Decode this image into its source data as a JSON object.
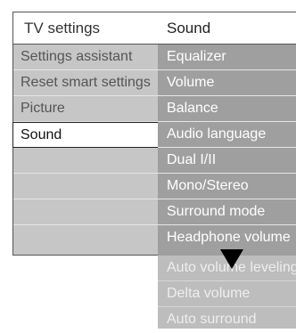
{
  "header": {
    "left_title": "TV settings",
    "right_title": "Sound"
  },
  "left_menu": {
    "items": [
      {
        "label": "Settings assistant"
      },
      {
        "label": "Reset smart settings"
      },
      {
        "label": "Picture"
      },
      {
        "label": "Sound",
        "selected": true
      }
    ]
  },
  "right_menu": {
    "items": [
      {
        "label": "Equalizer"
      },
      {
        "label": "Volume"
      },
      {
        "label": "Balance"
      },
      {
        "label": "Audio language"
      },
      {
        "label": "Dual I/II"
      },
      {
        "label": "Mono/Stereo"
      },
      {
        "label": "Surround mode"
      },
      {
        "label": "Headphone volume"
      }
    ],
    "more_items": [
      {
        "label": "Auto volume leveling"
      },
      {
        "label": "Delta volume"
      },
      {
        "label": "Auto surround"
      }
    ]
  },
  "icons": {
    "scroll_down": "triangle-down-icon"
  },
  "colors": {
    "left_panel": "#c6c6c6",
    "right_panel": "#9f9f9f",
    "right_panel_tail": "#bdbdbd",
    "selected_bg": "#ffffff"
  }
}
